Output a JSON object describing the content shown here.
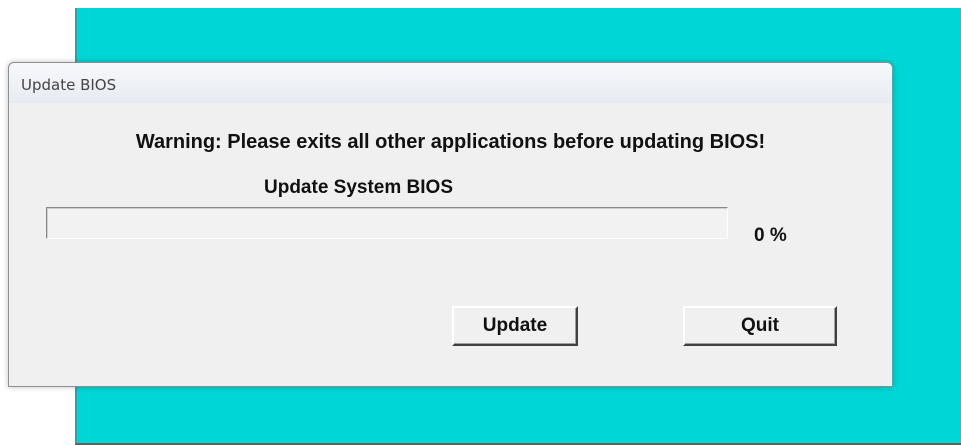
{
  "window": {
    "title": "Update BIOS"
  },
  "dialog": {
    "warning": "Warning: Please exits all other applications before updating BIOS!",
    "progress_label": "Update System BIOS",
    "progress_value": 0,
    "progress_text": "0 %"
  },
  "buttons": {
    "update_label": "Update",
    "quit_label": "Quit"
  },
  "colors": {
    "desktop_background": "#00d6d6",
    "dialog_background": "#f0f0f0"
  }
}
